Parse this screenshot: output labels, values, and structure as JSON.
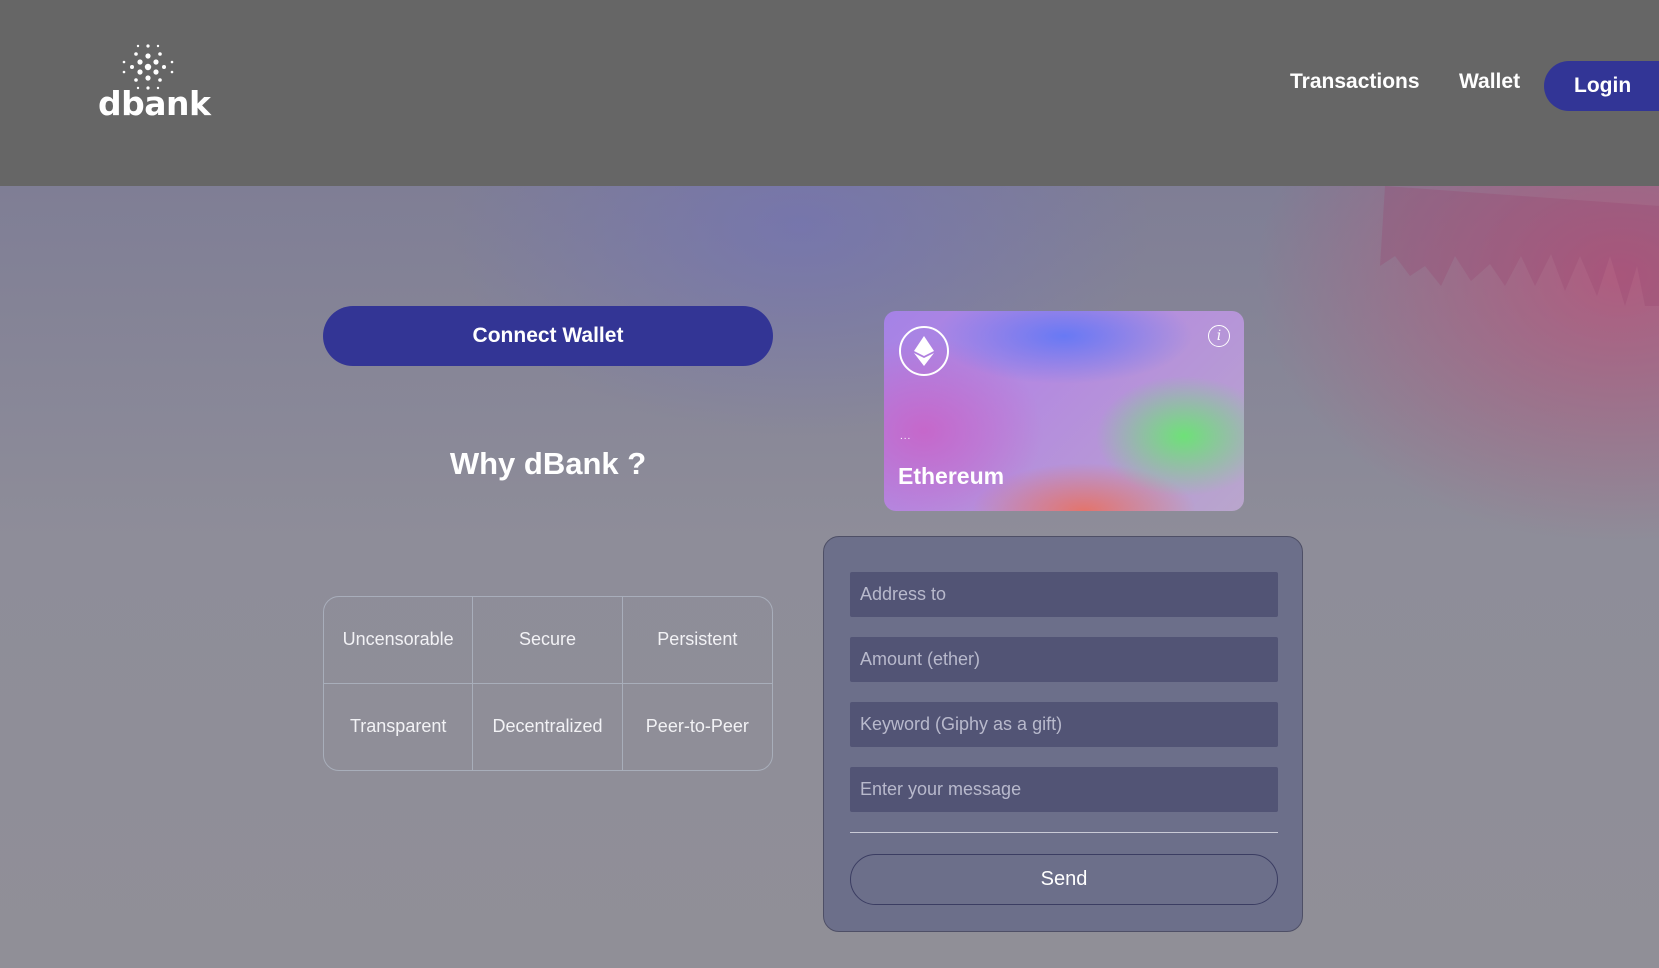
{
  "brand": {
    "name": "dbank"
  },
  "nav": {
    "transactions": "Transactions",
    "wallet": "Wallet",
    "login": "Login"
  },
  "hero": {
    "connect_wallet": "Connect Wallet",
    "why_title": "Why dBank ?",
    "features": [
      "Uncensorable",
      "Secure",
      "Persistent",
      "Transparent",
      "Decentralized",
      "Peer-to-Peer"
    ]
  },
  "card": {
    "currency": "Ethereum",
    "dots": "...",
    "icons": [
      "ethereum-icon",
      "info-icon"
    ]
  },
  "form": {
    "address_placeholder": "Address to",
    "amount_placeholder": "Amount (ether)",
    "keyword_placeholder": "Keyword (Giphy as a gift)",
    "message_placeholder": "Enter your message",
    "send": "Send"
  },
  "colors": {
    "header_bg": "#666666",
    "button_bg": "#333595",
    "panel_bg": "#666a87",
    "field_bg": "#525475"
  }
}
